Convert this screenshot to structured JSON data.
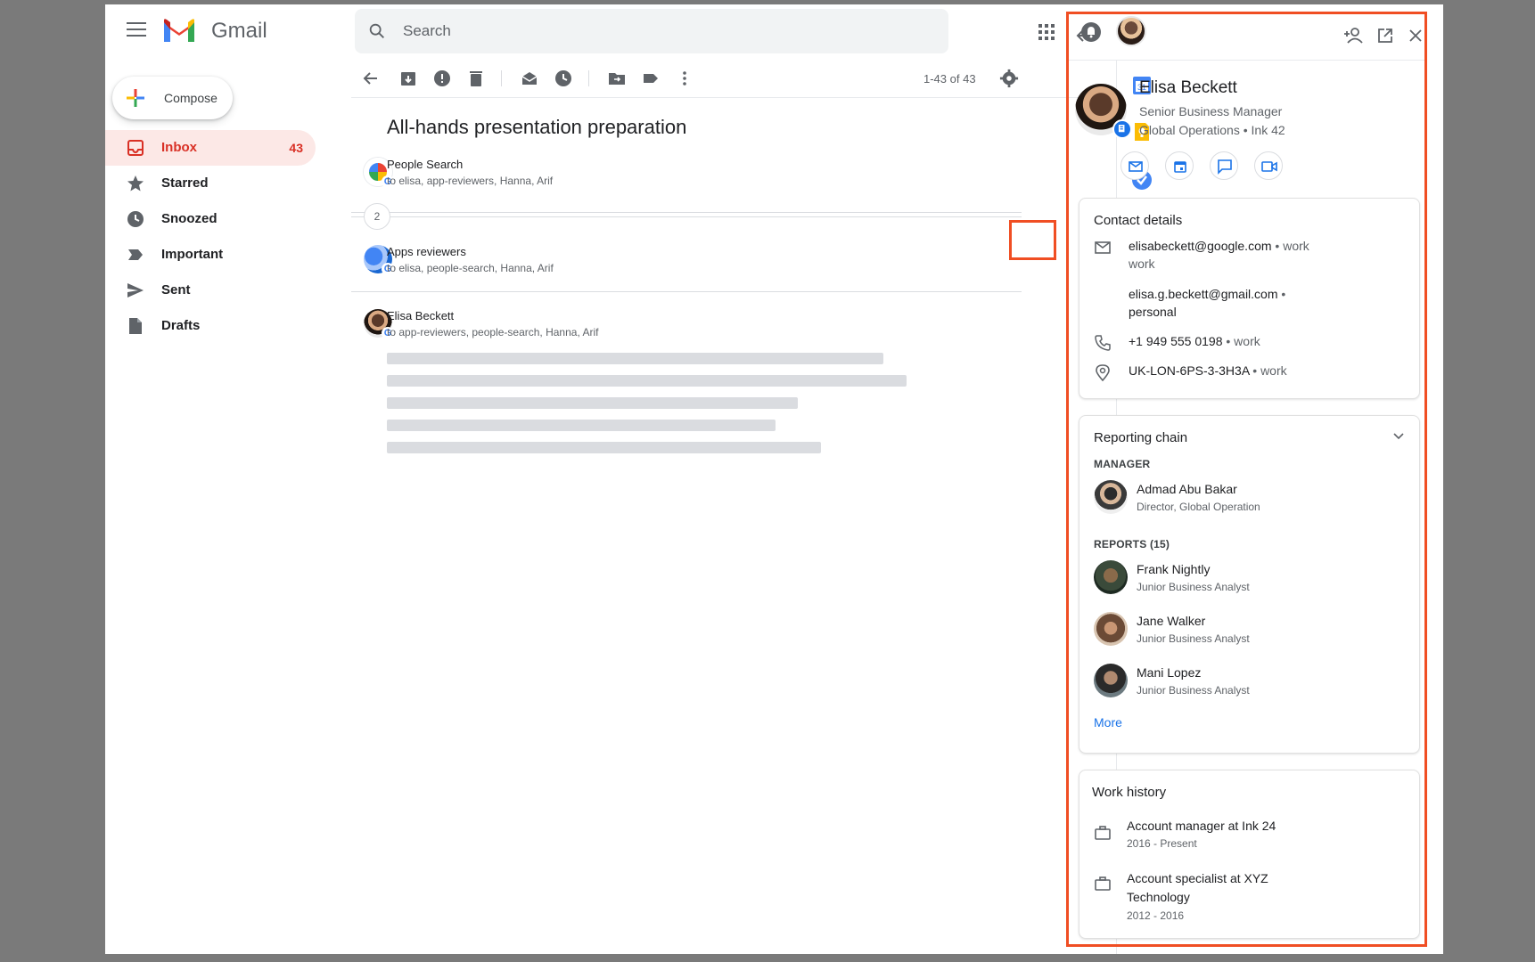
{
  "app": {
    "name": "Gmail"
  },
  "search": {
    "placeholder": "Search"
  },
  "compose": {
    "label": "Compose"
  },
  "nav": [
    {
      "label": "Inbox",
      "count": "43",
      "icon": "inbox-icon"
    },
    {
      "label": "Starred",
      "count": "",
      "icon": "star-icon"
    },
    {
      "label": "Snoozed",
      "count": "",
      "icon": "clock-icon"
    },
    {
      "label": "Important",
      "count": "",
      "icon": "important-icon"
    },
    {
      "label": "Sent",
      "count": "",
      "icon": "send-icon"
    },
    {
      "label": "Drafts",
      "count": "",
      "icon": "draft-icon"
    }
  ],
  "toolbar": {
    "count": "1-43 of 43"
  },
  "thread": {
    "subject": "All-hands presentation preparation",
    "collapsed_count": "2",
    "messages": [
      {
        "from": "People Search",
        "to": "to elisa, app-reviewers, Hanna, Arif"
      },
      {
        "from": "Apps reviewers",
        "to": "to elisa, people-search, Hanna, Arif"
      },
      {
        "from": "Elisa Beckett",
        "to": "to app-reviewers, people-search, Hanna, Arif"
      }
    ]
  },
  "contact": {
    "name": "Elisa Beckett",
    "title": "Senior Business Manager",
    "department": "Global Operations • Ink 42",
    "details_title": "Contact details",
    "email_work": "elisabeckett@google.com",
    "email_work_type": " • work",
    "email_work_label": "work",
    "email_personal": "elisa.g.beckett@gmail.com",
    "email_personal_type": " •",
    "email_personal_label": "personal",
    "phone": "+1 949 555 0198",
    "phone_label": " • work",
    "location": "UK-LON-6PS-3-3H3A",
    "location_label": " • work",
    "reporting_title": "Reporting chain",
    "manager_heading": "MANAGER",
    "manager": {
      "name": "Admad Abu Bakar",
      "role": "Director, Global Operation"
    },
    "reports_heading": "REPORTS (15)",
    "reports": [
      {
        "name": "Frank Nightly",
        "role": "Junior Business Analyst"
      },
      {
        "name": "Jane Walker",
        "role": "Junior Business Analyst"
      },
      {
        "name": "Mani Lopez",
        "role": "Junior Business Analyst"
      }
    ],
    "more": "More",
    "work_title": "Work history",
    "work": [
      {
        "title": "Account manager at Ink 24",
        "years": "2016 - Present"
      },
      {
        "title_line1": "Account specialist at XYZ",
        "title_line2": "Technology",
        "years": "2012 - 2016"
      }
    ]
  },
  "colors": {
    "accent": "#1a73e8",
    "highlight": "#f04e23",
    "inbox_red": "#d93025"
  }
}
